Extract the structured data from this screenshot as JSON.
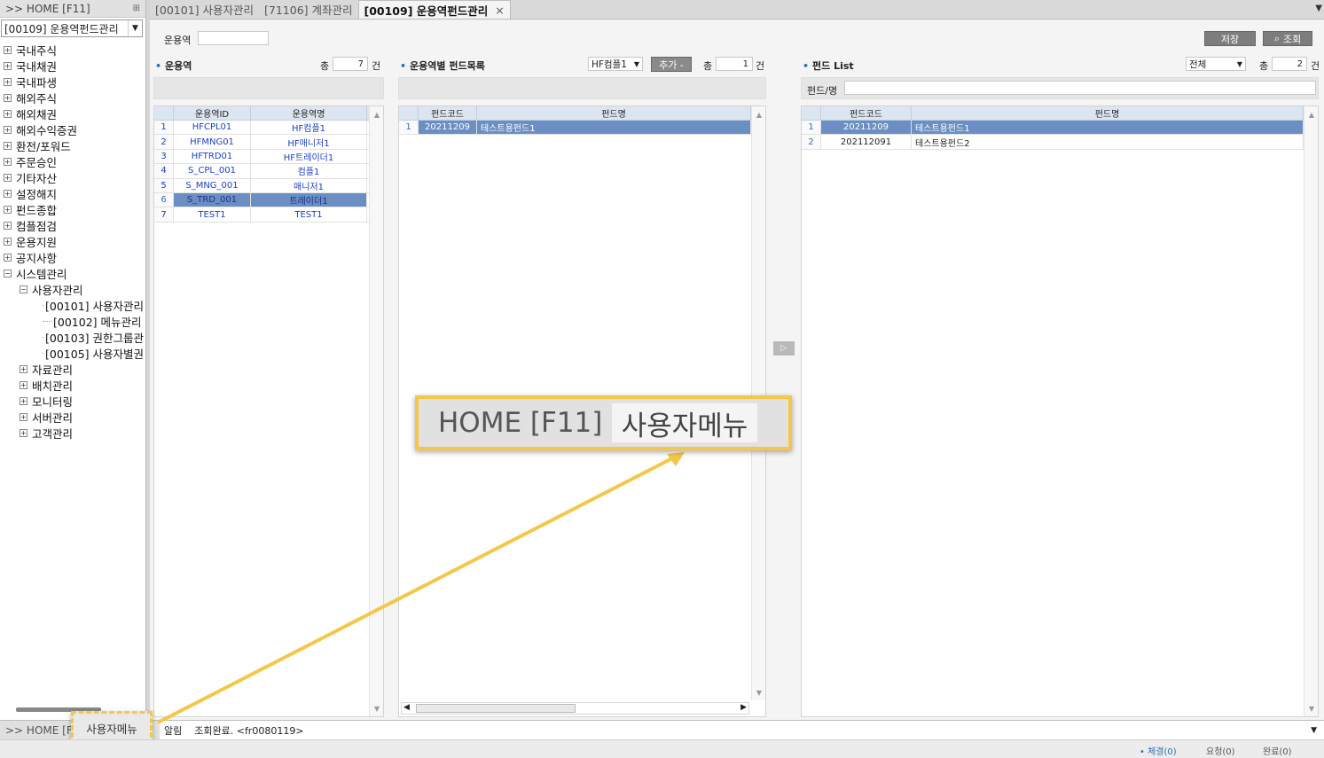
{
  "left_panel": {
    "header": ">> HOME [F11]",
    "menu_select": "[00109] 운용역펀드관리",
    "tree_top": [
      "국내주식",
      "국내채권",
      "국내파생",
      "해외주식",
      "해외채권",
      "해외수익증권",
      "환전/포워드",
      "주문승인",
      "기타자산",
      "설정해지",
      "펀드종합",
      "컴플점검",
      "운용지원",
      "공지사항"
    ],
    "system_mgmt": "시스템관리",
    "user_mgmt": "사용자관리",
    "user_mgmt_children": [
      "[00101] 사용자관리",
      "[00102] 메뉴관리",
      "[00103] 권한그룹관",
      "[00105] 사용자별권"
    ],
    "system_children": [
      "자료관리",
      "배치관리",
      "모니터링",
      "서버관리",
      "고객관리"
    ]
  },
  "tabs": [
    {
      "label": "[00101] 사용자관리"
    },
    {
      "label": "[71106] 계좌관리"
    },
    {
      "label": "[00109] 운용역펀드관리",
      "close": "×"
    }
  ],
  "main": {
    "search_label": "운용역",
    "save_btn": "저장",
    "query_btn": "조회",
    "manager_section": {
      "title": "운용역",
      "total_label": "총",
      "count": "7",
      "unit": "건",
      "columns": [
        "운용역ID",
        "운용역명"
      ],
      "rows": [
        {
          "n": "1",
          "id": "HFCPL01",
          "name": "HF컴플1"
        },
        {
          "n": "2",
          "id": "HFMNG01",
          "name": "HF매니저1"
        },
        {
          "n": "3",
          "id": "HFTRD01",
          "name": "HF트레이더1"
        },
        {
          "n": "4",
          "id": "S_CPL_001",
          "name": "컴플1"
        },
        {
          "n": "5",
          "id": "S_MNG_001",
          "name": "매니저1"
        },
        {
          "n": "6",
          "id": "S_TRD_001",
          "name": "트레이더1"
        },
        {
          "n": "7",
          "id": "TEST1",
          "name": "TEST1"
        }
      ]
    },
    "fund_by_manager": {
      "title": "운용역별 펀드목록",
      "select_value": "HF컴플1",
      "add_btn": "추가 -",
      "total_label": "총",
      "count": "1",
      "unit": "건",
      "columns": [
        "펀드코드",
        "펀드명"
      ],
      "rows": [
        {
          "n": "1",
          "code": "20211209",
          "name": "테스트용펀드1"
        }
      ]
    },
    "transfer_btn": "▷",
    "fund_list": {
      "title": "펀드 List",
      "select_value": "전체",
      "total_label": "총",
      "count": "2",
      "unit": "건",
      "filter_label": "펀드/명",
      "columns": [
        "펀드코드",
        "펀드명"
      ],
      "rows": [
        {
          "n": "1",
          "code": "20211209",
          "name": "테스트용펀드1"
        },
        {
          "n": "2",
          "code": "202112091",
          "name": "테스트용펀드2"
        }
      ]
    }
  },
  "bottom": {
    "home_tab": ">> HOME [F",
    "user_menu_tab": "사용자메뉴",
    "status_label": "알림",
    "status_text": "조회완료. <fr0080119>",
    "footer": [
      "• 체결(0)",
      "요청(0)",
      "완료(0)"
    ]
  },
  "callout": {
    "home": "HOME [F11]",
    "user_menu": "사용자메뉴"
  },
  "colors": {
    "highlight": "#f4c74a",
    "selected_row": "#6b8fc2",
    "header_bg": "#dce6f1"
  }
}
